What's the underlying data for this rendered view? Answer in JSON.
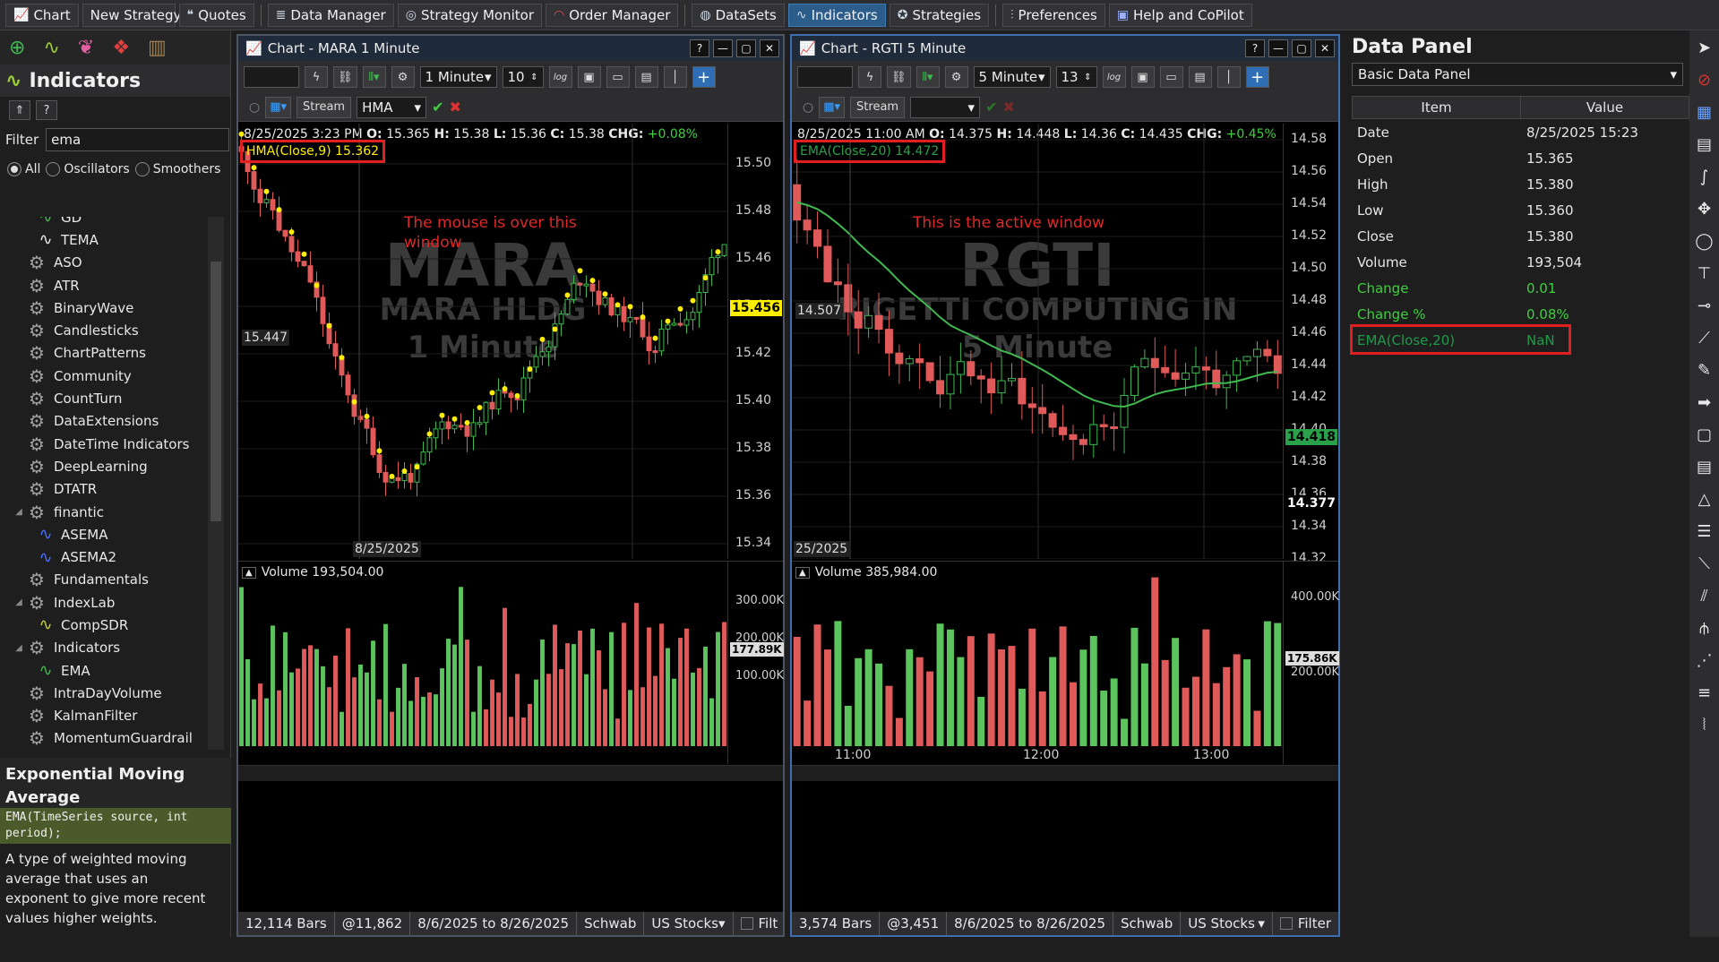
{
  "toolbar": {
    "chart": "Chart",
    "new_strategy": "New Strategy",
    "quotes": "Quotes",
    "data_manager": "Data Manager",
    "strategy_monitor": "Strategy Monitor",
    "order_manager": "Order Manager",
    "datasets": "DataSets",
    "indicators": "Indicators",
    "strategies": "Strategies",
    "preferences": "Preferences",
    "help": "Help and CoPilot"
  },
  "left": {
    "title": "Indicators",
    "filter_label": "Filter",
    "filter_value": "ema",
    "radio_all": "All",
    "radio_osc": "Oscillators",
    "radio_smooth": "Smoothers",
    "items": [
      {
        "label": "GD",
        "kind": "wave",
        "indent": 2
      },
      {
        "label": "TEMA",
        "kind": "wave-white",
        "indent": 2
      },
      {
        "label": "ASO",
        "kind": "gear",
        "indent": 1
      },
      {
        "label": "ATR",
        "kind": "gear",
        "indent": 1
      },
      {
        "label": "BinaryWave",
        "kind": "gear",
        "indent": 1
      },
      {
        "label": "Candlesticks",
        "kind": "gear",
        "indent": 1
      },
      {
        "label": "ChartPatterns",
        "kind": "gear",
        "indent": 1
      },
      {
        "label": "Community",
        "kind": "gear",
        "indent": 1
      },
      {
        "label": "CountTurn",
        "kind": "gear",
        "indent": 1
      },
      {
        "label": "DataExtensions",
        "kind": "gear",
        "indent": 1
      },
      {
        "label": "DateTime Indicators",
        "kind": "gear",
        "indent": 1
      },
      {
        "label": "DeepLearning",
        "kind": "gear",
        "indent": 1
      },
      {
        "label": "DTATR",
        "kind": "gear",
        "indent": 1
      },
      {
        "label": "finantic",
        "kind": "gear",
        "indent": 1,
        "open": true
      },
      {
        "label": "ASEMA",
        "kind": "wave-blue",
        "indent": 2
      },
      {
        "label": "ASEMA2",
        "kind": "wave-blue",
        "indent": 2
      },
      {
        "label": "Fundamentals",
        "kind": "gear",
        "indent": 1
      },
      {
        "label": "IndexLab",
        "kind": "gear",
        "indent": 1,
        "open": true
      },
      {
        "label": "CompSDR",
        "kind": "wave-yellow",
        "indent": 2
      },
      {
        "label": "Indicators",
        "kind": "gear",
        "indent": 1,
        "open": true
      },
      {
        "label": "EMA",
        "kind": "wave",
        "indent": 2
      },
      {
        "label": "IntraDayVolume",
        "kind": "gear",
        "indent": 1
      },
      {
        "label": "KalmanFilter",
        "kind": "gear",
        "indent": 1
      },
      {
        "label": "MomentumGuardrail",
        "kind": "gear",
        "indent": 1
      }
    ],
    "desc_title": "Exponential Moving Average",
    "desc_sig": "EMA(TimeSeries source, int period);",
    "desc_body": "A type of weighted moving average that uses an exponent to give more recent values higher weights."
  },
  "chart1": {
    "title": "Chart - MARA 1 Minute",
    "scale": "1 Minute",
    "bars_input": "10",
    "stream": "Stream",
    "indicator_field": "HMA",
    "ohlc": {
      "date": "8/25/2025 3:23 PM",
      "o": "15.365",
      "h": "15.38",
      "l": "15.36",
      "c": "15.38",
      "chg": "+0.08%"
    },
    "ind_label": "HMA(Close,9) 15.362",
    "wm_symbol": "MARA",
    "wm_name": "MARA HLDG",
    "wm_scale": "1 Minute",
    "annotation": "The mouse is over this window",
    "cursor_price": "15.447",
    "date_label": "8/25/2025",
    "last_price": "15.456",
    "yticks": [
      "15.50",
      "15.48",
      "15.46",
      "15.44",
      "15.42",
      "15.40",
      "15.38",
      "15.36",
      "15.34"
    ],
    "volume_label": "Volume 193,504.00",
    "vol_ticks": [
      "300.00K",
      "200.00K",
      "100.00K"
    ],
    "vol_tag": "177.89K",
    "status": {
      "bars": "12,114 Bars",
      "pos": "@11,862",
      "range": "8/6/2025 to 8/26/2025",
      "provider": "Schwab",
      "market": "US Stocks",
      "filter": "Filt"
    }
  },
  "chart2": {
    "title": "Chart - RGTI 5 Minute",
    "scale": "5 Minute",
    "bars_input": "13",
    "stream": "Stream",
    "ohlc": {
      "date": "8/25/2025 11:00 AM",
      "o": "14.375",
      "h": "14.448",
      "l": "14.36",
      "c": "14.435",
      "chg": "+0.45%"
    },
    "ind_label": "EMA(Close,20) 14.472",
    "wm_symbol": "RGTI",
    "wm_name": "RIGETTI COMPUTING IN",
    "wm_scale": "5 Minute",
    "annotation": "This is the active window",
    "cursor_price": "14.507",
    "date_label": "25/2025",
    "ema_tag": "14.418",
    "last_price": "14.377",
    "yticks": [
      "14.58",
      "14.56",
      "14.54",
      "14.52",
      "14.50",
      "14.48",
      "14.46",
      "14.44",
      "14.42",
      "14.40",
      "14.38",
      "14.36",
      "14.34",
      "14.32"
    ],
    "volume_label": "Volume 385,984.00",
    "vol_ticks": [
      "400.00K",
      "200.00K"
    ],
    "vol_tag": "175.86K",
    "xticks": [
      "11:00",
      "12:00",
      "13:00"
    ],
    "status": {
      "bars": "3,574 Bars",
      "pos": "@3,451",
      "range": "8/6/2025 to 8/26/2025",
      "provider": "Schwab",
      "market": "US Stocks",
      "filter": "Filter"
    }
  },
  "datapanel": {
    "title": "Data Panel",
    "selector": "Basic Data Panel",
    "col_item": "Item",
    "col_value": "Value",
    "rows": [
      {
        "item": "Date",
        "value": "8/25/2025 15:23"
      },
      {
        "item": "Open",
        "value": "15.365"
      },
      {
        "item": "High",
        "value": "15.380"
      },
      {
        "item": "Low",
        "value": "15.360"
      },
      {
        "item": "Close",
        "value": "15.380"
      },
      {
        "item": "Volume",
        "value": "193,504"
      },
      {
        "item": "Change",
        "value": "0.01"
      },
      {
        "item": "Change %",
        "value": "0.08%"
      },
      {
        "item": "EMA(Close,20)",
        "value": "NaN"
      }
    ]
  }
}
